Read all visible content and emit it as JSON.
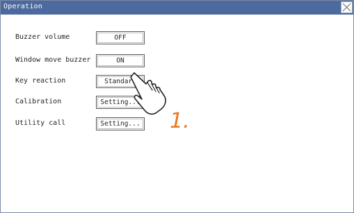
{
  "window": {
    "title": "Operation"
  },
  "rows": [
    {
      "label": "Buzzer volume",
      "value": "OFF"
    },
    {
      "label": "Window move buzzer",
      "value": "ON"
    },
    {
      "label": "Key reaction",
      "value": "Standard"
    },
    {
      "label": "Calibration",
      "value": "Setting..."
    },
    {
      "label": "Utility call",
      "value": "Setting..."
    }
  ],
  "annotation": {
    "step": "1.",
    "color": "#e8791f"
  },
  "icons": {
    "close": "close-icon",
    "pointer": "hand-pointer-icon"
  },
  "colors": {
    "titlebar": "#4d6a9e",
    "background": "#ffffff"
  }
}
